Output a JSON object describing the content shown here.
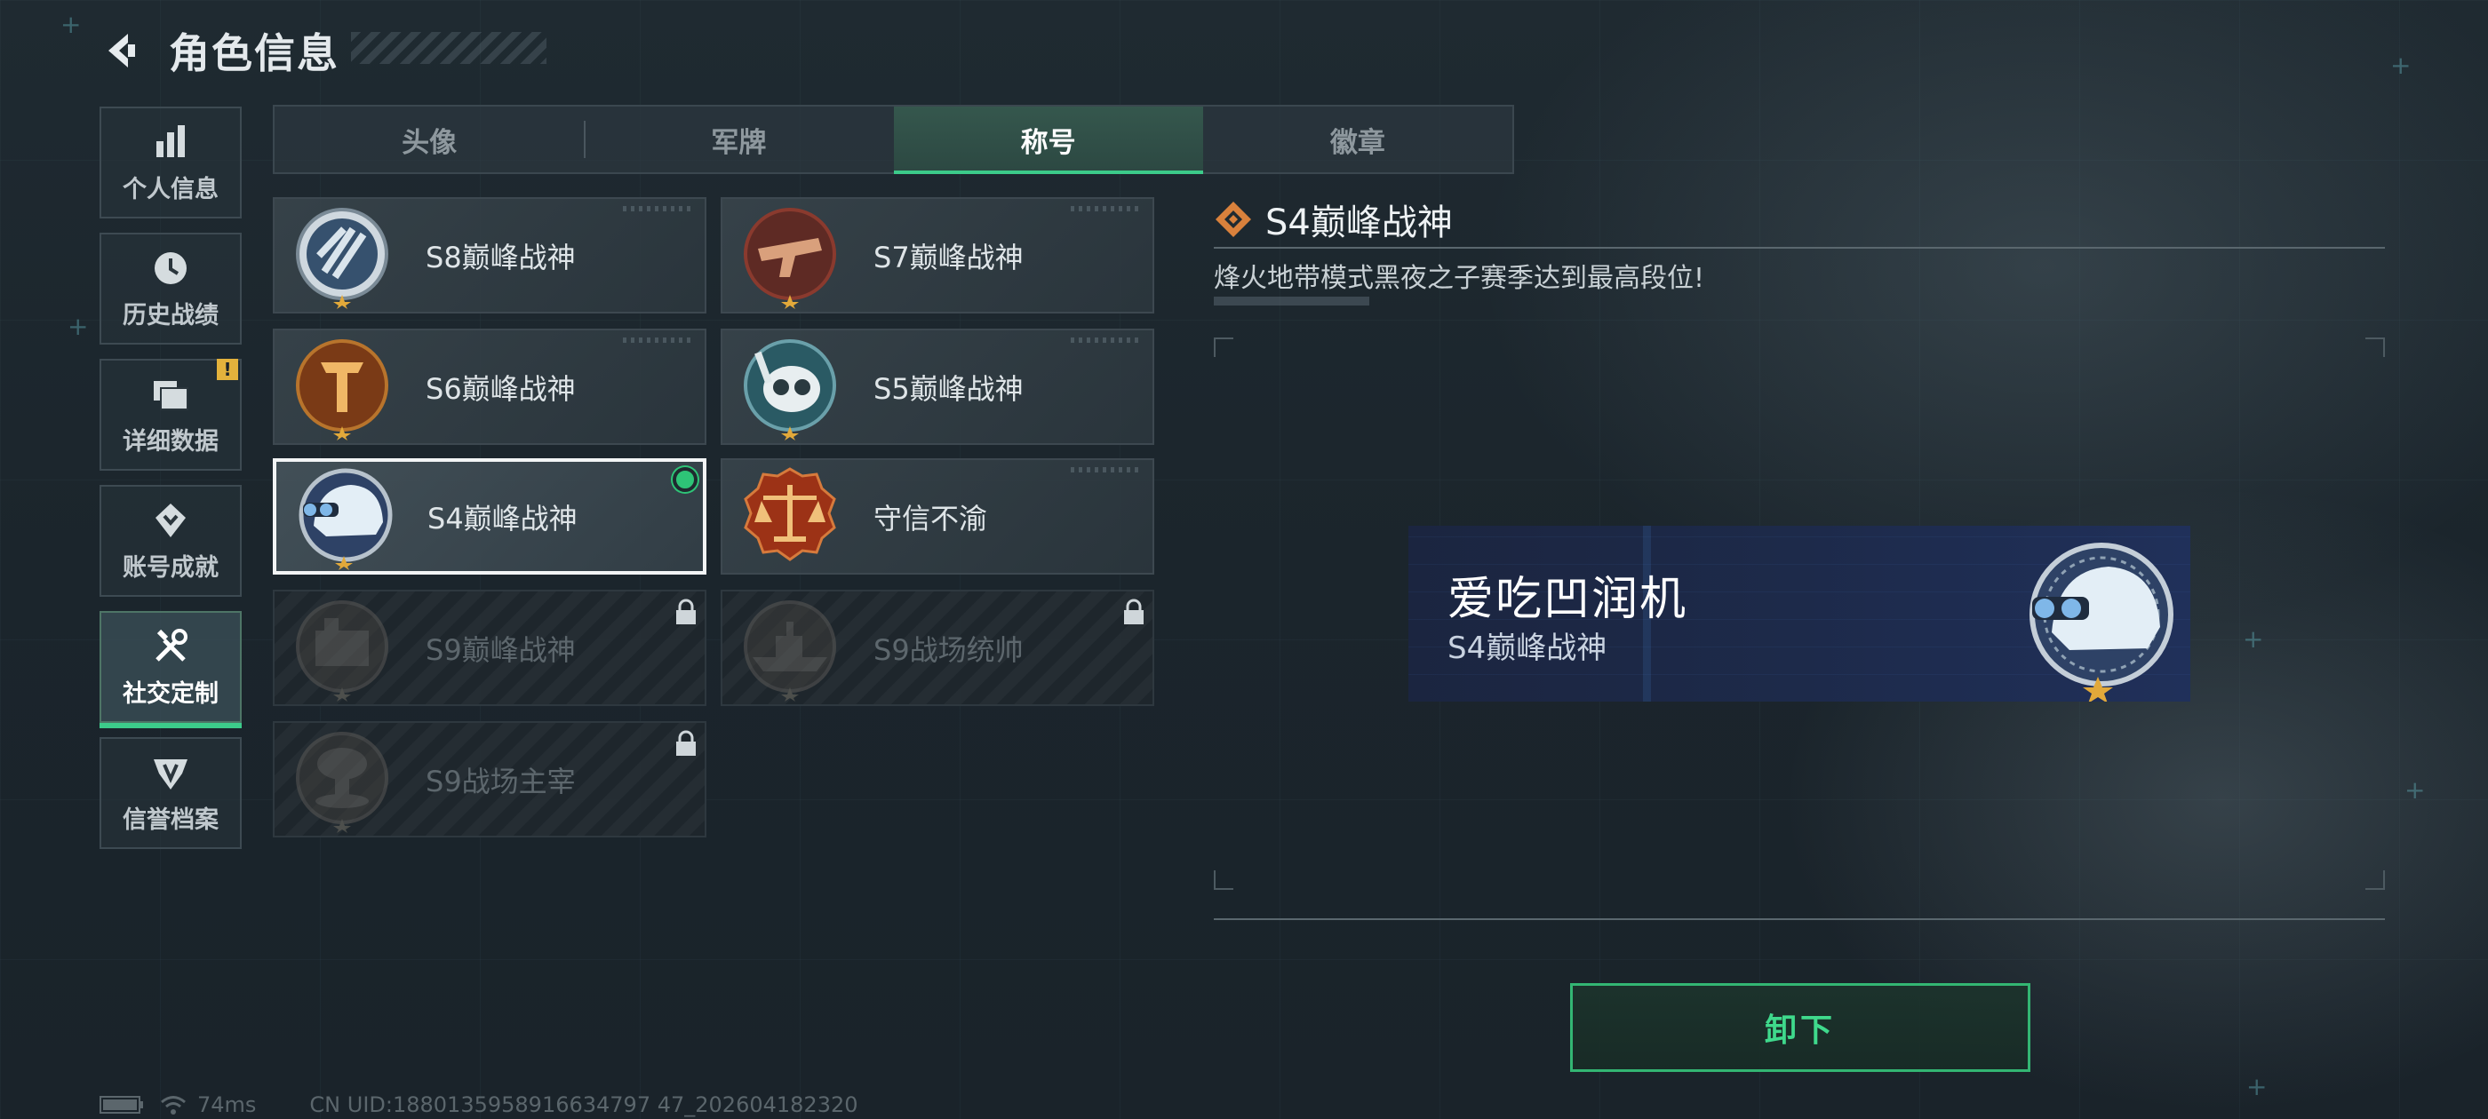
{
  "header": {
    "title": "角色信息"
  },
  "sidebar": {
    "items": [
      {
        "label": "个人信息",
        "icon": "bar-chart-icon"
      },
      {
        "label": "历史战绩",
        "icon": "clock-icon"
      },
      {
        "label": "详细数据",
        "icon": "folder-icon",
        "badge": "!"
      },
      {
        "label": "账号成就",
        "icon": "achievement-icon"
      },
      {
        "label": "社交定制",
        "icon": "tools-icon",
        "active": true
      },
      {
        "label": "信誉档案",
        "icon": "shield-icon"
      }
    ]
  },
  "tabs": [
    {
      "label": "头像"
    },
    {
      "label": "军牌"
    },
    {
      "label": "称号",
      "active": true
    },
    {
      "label": "徽章"
    }
  ],
  "titles": [
    {
      "name": "S8巅峰战神",
      "icon": "s8-emblem-icon",
      "state": "unlocked"
    },
    {
      "name": "S7巅峰战神",
      "icon": "s7-emblem-icon",
      "state": "unlocked"
    },
    {
      "name": "S6巅峰战神",
      "icon": "s6-emblem-icon",
      "state": "unlocked"
    },
    {
      "name": "S5巅峰战神",
      "icon": "s5-emblem-icon",
      "state": "unlocked"
    },
    {
      "name": "S4巅峰战神",
      "icon": "s4-helmet-emblem-icon",
      "state": "equipped"
    },
    {
      "name": "守信不渝",
      "icon": "scales-emblem-icon",
      "state": "unlocked"
    },
    {
      "name": "S9巅峰战神",
      "icon": "s9-emblem-icon",
      "state": "locked"
    },
    {
      "name": "S9战场统帅",
      "icon": "warship-emblem-icon",
      "state": "locked"
    },
    {
      "name": "S9战场主宰",
      "icon": "mushroom-cloud-emblem-icon",
      "state": "locked"
    }
  ],
  "detail": {
    "title": "S4巅峰战神",
    "description": "烽火地带模式黑夜之子赛季达到最高段位!"
  },
  "preview": {
    "player_name": "爱吃凹润机",
    "title": "S4巅峰战神"
  },
  "actions": {
    "unequip_label": "卸下"
  },
  "status": {
    "ping": "74ms",
    "uid": "CN UID:1880135958916634797 47_202604182320"
  },
  "colors": {
    "accent": "#3ccb8a",
    "warning": "#e3b23c",
    "background": "#1d272e"
  }
}
